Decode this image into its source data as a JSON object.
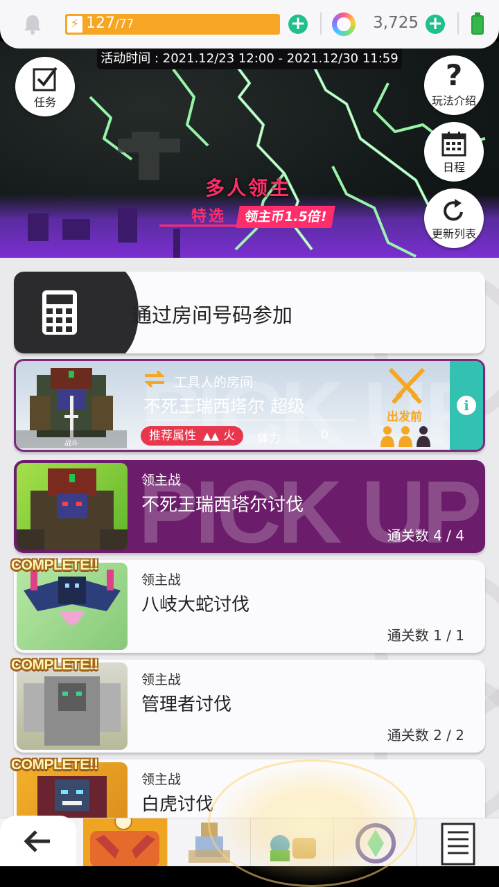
{
  "status_bar": {
    "stamina_current": "127",
    "stamina_max": "/77",
    "coins": "3,725",
    "colors": {
      "stamina": "#f6a623",
      "plus": "#22bf8e"
    }
  },
  "banner": {
    "event_time": "活动时间 : 2021.12/23 12:00 - 2021.12/30 11:59",
    "title": "多人领主",
    "subtitle": "特选",
    "tag": "领主币1.5倍!",
    "left_button_label": "任务",
    "right_buttons": [
      {
        "label": "玩法介绍",
        "icon": "question-icon"
      },
      {
        "label": "日程",
        "icon": "calendar-icon"
      },
      {
        "label": "更新列表",
        "icon": "refresh-icon"
      }
    ]
  },
  "join_card": {
    "label": "通过房间号码参加",
    "icon": "calculator-icon"
  },
  "room_card": {
    "host": "工具人的房间",
    "boss_name": "不死王瑞西塔尔 超级",
    "attr_label": "推荐属性",
    "attr_value": "火",
    "stamina_label": "体力",
    "stamina_value": "0",
    "status": "出发前",
    "thumb_label": "战斗",
    "pickup_text": "PICK UP"
  },
  "quests": [
    {
      "category": "领主战",
      "name": "不死王瑞西塔尔讨伐",
      "clear": "通关数 4 / 4",
      "pickup": "PICK UP",
      "complete": ""
    },
    {
      "category": "领主战",
      "name": "八岐大蛇讨伐",
      "clear": "通关数 1 / 1",
      "complete": "COMPLETE!!"
    },
    {
      "category": "领主战",
      "name": "管理者讨伐",
      "clear": "通关数 2 / 2",
      "complete": "COMPLETE!!"
    },
    {
      "category": "领主战",
      "name": "白虎讨伐",
      "clear": "",
      "complete": "COMPLETE!!"
    }
  ],
  "bottom_nav": {
    "items": [
      "back-arrow-icon",
      "boss-icon",
      "knight-icon",
      "items-icon",
      "crest-icon",
      "list-icon"
    ]
  }
}
